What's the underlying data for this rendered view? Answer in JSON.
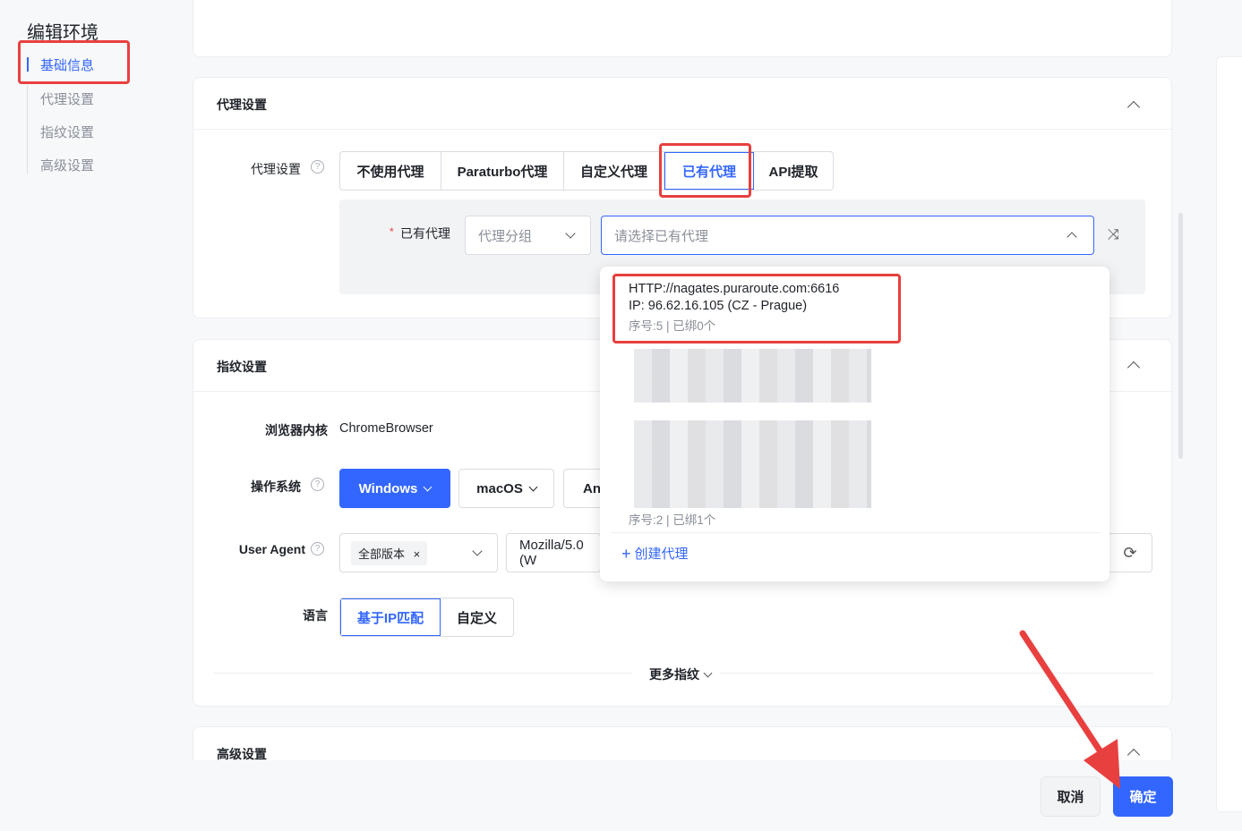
{
  "page": {
    "title": "编辑环境"
  },
  "nav": {
    "items": [
      {
        "label": "基础信息",
        "active": true
      },
      {
        "label": "代理设置",
        "active": false
      },
      {
        "label": "指纹设置",
        "active": false
      },
      {
        "label": "高级设置",
        "active": false
      }
    ]
  },
  "proxy_section": {
    "title": "代理设置",
    "field_label": "代理设置",
    "tabs": [
      "不使用代理",
      "Paraturbo代理",
      "自定义代理",
      "已有代理",
      "API提取"
    ],
    "selected_tab": "已有代理",
    "existing_label": "已有代理",
    "required_mark": "*",
    "group_placeholder": "代理分组",
    "proxy_placeholder": "请选择已有代理"
  },
  "dropdown": {
    "option1": {
      "url": "HTTP://nagates.puraroute.com:6616",
      "ip": "IP: 96.62.16.105 (CZ - Prague)",
      "meta": "序号:5 | 已绑0个"
    },
    "option2_meta": "序号:2 | 已绑1个",
    "create_label": "创建代理",
    "create_icon": "plus-icon"
  },
  "fingerprint_section": {
    "title": "指纹设置",
    "kernel_label": "浏览器内核",
    "kernel_value": "ChromeBrowser",
    "os_label": "操作系统",
    "os_buttons": [
      "Windows",
      "macOS",
      "An"
    ],
    "ua_label": "User Agent",
    "ua_tag": "全部版本",
    "ua_value": "Mozilla/5.0 (W",
    "lang_label": "语言",
    "lang_options": [
      "基于IP匹配",
      "自定义"
    ],
    "more_label": "更多指纹"
  },
  "advanced_section": {
    "title": "高级设置"
  },
  "footer": {
    "cancel": "取消",
    "confirm": "确定"
  },
  "colors": {
    "accent": "#3366ff",
    "highlight": "#e8403f"
  }
}
